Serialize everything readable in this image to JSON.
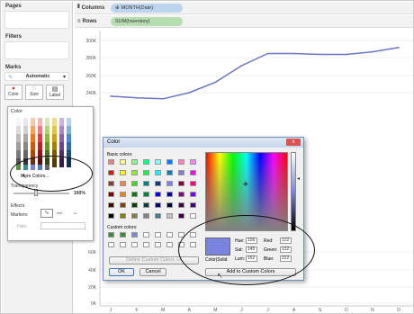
{
  "left_pane": {
    "pages_title": "Pages",
    "filters_title": "Filters",
    "marks_title": "Marks",
    "mark_type": "Automatic",
    "color_label": "Color",
    "size_label": "Size",
    "label_label": "Label"
  },
  "shelves": {
    "columns_label": "Columns",
    "columns_pill": "MONTH(Date)",
    "rows_label": "Rows",
    "rows_pill": "SUM(Inventory)"
  },
  "color_popup": {
    "title": "Color",
    "more_colors": "More Colors...",
    "transparency": "Transparency",
    "transparency_value": "100%",
    "effects": "Effects",
    "markers": "Markers:",
    "halo": "Halo:"
  },
  "dialog": {
    "title": "Color",
    "basic_colors_label": "Basic colors:",
    "custom_colors_label": "Custom colors:",
    "define_button": "Define Custom Colors >>",
    "ok_button": "OK",
    "cancel_button": "Cancel",
    "add_button": "Add to Custom Colors",
    "colorsolid_label": "Color|Solid",
    "hue_label": "Hue:",
    "hue": "156",
    "sat_label": "Sat:",
    "sat": "145",
    "lum_label": "Lum:",
    "lum": "162",
    "red_label": "Red:",
    "red": "122",
    "green_label": "Green:",
    "green": "132",
    "blue_label": "Blue:",
    "blue": "222",
    "close_icon_label": "x"
  },
  "chart_data": {
    "type": "line",
    "categories": [
      "J",
      "F",
      "M",
      "A",
      "M",
      "J",
      "J",
      "A",
      "S",
      "O",
      "N",
      "D"
    ],
    "y_ticks": [
      "300K",
      "280K",
      "260K",
      "240K",
      "60K",
      "40K",
      "20K",
      "0K"
    ],
    "ylim": [
      0,
      300000
    ],
    "series": [
      {
        "values": [
          236000,
          234000,
          233000,
          240000,
          252000,
          271000,
          285000,
          285000,
          284000,
          284000,
          287000,
          292000
        ],
        "color": "#6c76c0"
      }
    ]
  }
}
